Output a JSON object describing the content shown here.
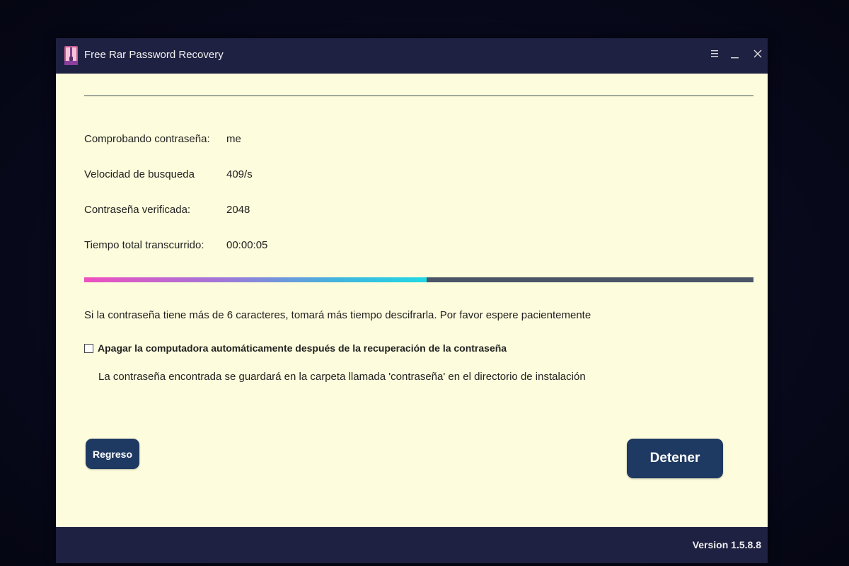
{
  "window": {
    "title": "Free Rar Password Recovery",
    "icon": "rar-archive-icon"
  },
  "titlebar_controls": [
    {
      "name": "menu",
      "icon": "hamburger-menu-icon"
    },
    {
      "name": "minimize",
      "icon": "minimize-icon"
    },
    {
      "name": "close",
      "icon": "close-icon"
    }
  ],
  "status": {
    "checking_label": "Comprobando contraseña:",
    "checking_value": "me",
    "speed_label": "Velocidad de busqueda",
    "speed_value": "409/s",
    "verified_label": "Contraseña verificada:",
    "verified_value": "2048",
    "elapsed_label": "Tiempo total transcurrido:",
    "elapsed_value": "00:00:05"
  },
  "progress": {
    "fraction": 0.512
  },
  "hint": "Si la contraseña tiene más de 6 caracteres, tomará más tiempo descifrarla. Por favor espere pacientemente",
  "shutdown_option": {
    "label": "Apagar la computadora automáticamente después de la recuperación de la contraseña",
    "checked": false
  },
  "save_note": "La contraseña encontrada se guardará en la carpeta llamada 'contraseña' en el directorio de instalación",
  "buttons": {
    "back_label": "Regreso",
    "stop_label": "Detener"
  },
  "footer": {
    "version": "Version 1.5.8.8"
  },
  "colors": {
    "titlebar": "#1f2142",
    "content_bg": "#fdfcdc",
    "button": "#1f3a62",
    "progress_track": "#4b5568",
    "progress_start": "#ef4fbf",
    "progress_end": "#21d8e4"
  }
}
